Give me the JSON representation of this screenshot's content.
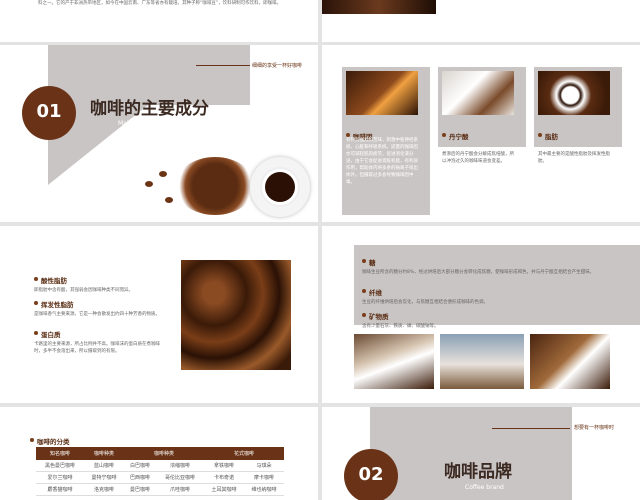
{
  "s1": {
    "text": "料之一。它的产于非洲热带地区，如今在中国云南、广东等省亦有栽培。其种子称“咖啡豆”，饮料研制可作饮料，即咖啡。"
  },
  "s2": {
    "number": "01",
    "title": "咖啡的主要成分",
    "subtitle": "Main ingredients of coffee",
    "tagline": "细细的享受一杯好咖啡",
    "cards": [
      {
        "title": "咖啡因",
        "text": "有特别强烈的苦味，刺激中枢神经系统、心脏和呼吸系统。适量的咖啡因亦可减轻肌肉疲劳，促进消化液分泌。由于它会促进肾脏机能，有利尿作用，帮助体内将多余的钠离子排出体外。但摄取过多会导致咖啡因中毒。"
      },
      {
        "title": "丹宁酸",
        "text": "煮沸后的丹宁酸会分解成焦棓酸，所以冲泡过久的咖啡味道会变差。"
      },
      {
        "title": "脂肪",
        "text": "其中最主要的是酸性脂肪及挥发性脂肪。"
      }
    ]
  },
  "s3": {
    "items": [
      {
        "title": "酸性脂肪",
        "text": "即脂肪中含有酸，其强弱会因咖啡种类不同而异。"
      },
      {
        "title": "挥发性脂肪",
        "text": "是咖啡香气主要来源，它是一种会散发出约四十种芳香的物质。"
      },
      {
        "title": "蛋白质",
        "text": "卡路里的主要来源，所占比例并不高。咖啡沫的蛋白质在煮咖啡时，多半不会溶出来，所以摄取到的有限。"
      }
    ]
  },
  "s4": {
    "items": [
      {
        "title": "糖",
        "text": "咖啡生豆所含的糖分约8%，经过烘焙后大部分糖分会转化成焦糖，使咖啡形成褐色，并与丹宁酸互相结合产生甜味。"
      },
      {
        "title": "纤维",
        "text": "生豆的纤维烘焙后会炭化，与焦糖互相结合便形成咖啡的色调。"
      },
      {
        "title": "矿物质",
        "text": "含有少量石灰、铁质、磷、碳酸钠等。"
      }
    ]
  },
  "s5": {
    "title": "咖啡的分类",
    "headers": [
      "知名咖啡",
      "咖啡种类",
      "咖啡种类",
      "花式咖啡"
    ],
    "rows": [
      [
        "黑色曼巴咖啡",
        "蓝山咖啡",
        "白巴咖啡",
        "浓缩咖啡",
        "拿铁咖啡",
        "马琪朵"
      ],
      [
        "爱尔兰咖啡",
        "曼特宁咖啡",
        "巴西咖啡",
        "哥伦比亚咖啡",
        "卡布奇诺",
        "摩卡咖啡"
      ],
      [
        "麝香猫咖啡",
        "洛克咖啡",
        "曼巴咖啡",
        "爪哇咖啡",
        "土耳其咖啡",
        "维也纳咖啡"
      ]
    ]
  },
  "s6": {
    "number": "02",
    "title": "咖啡品牌",
    "subtitle": "Coffee brand",
    "tagline": "想要有一杯咖啡时"
  },
  "colors": {
    "brown": "#6a3317",
    "grey": "#c9c5c4",
    "accent": "#7a3e1a"
  }
}
